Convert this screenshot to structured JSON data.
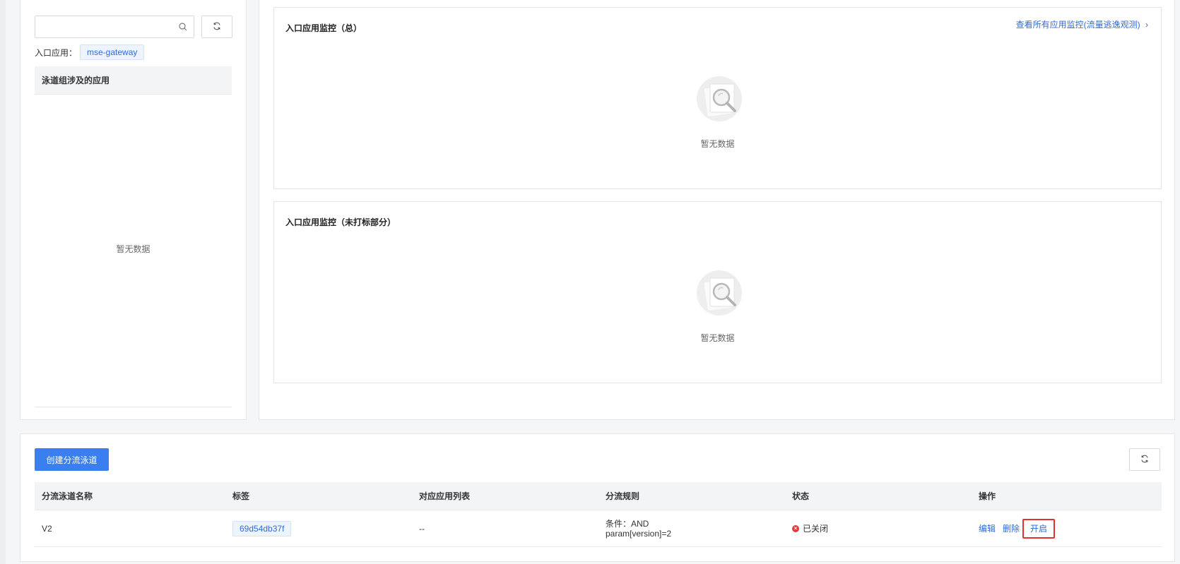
{
  "left_panel": {
    "search": {
      "value": "",
      "placeholder": ""
    },
    "entry_label": "入口应用：",
    "entry_tag": "mse-gateway",
    "list_header": "泳道组涉及的应用",
    "empty_text": "暂无数据"
  },
  "monitors": [
    {
      "title": "入口应用监控（总）",
      "link": "查看所有应用监控(流量逃逸观测)",
      "empty_text": "暂无数据"
    },
    {
      "title": "入口应用监控（未打标部分）",
      "empty_text": "暂无数据"
    }
  ],
  "lanes": {
    "create_button": "创建分流泳道",
    "columns": [
      "分流泳道名称",
      "标签",
      "对应应用列表",
      "分流规则",
      "状态",
      "操作"
    ],
    "rows": [
      {
        "name": "V2",
        "tag": "69d54db37f",
        "apps": "--",
        "rule_line1": "条件：AND",
        "rule_line2": "param[version]=2",
        "status": "已关闭",
        "actions": {
          "edit": "编辑",
          "delete": "删除",
          "enable": "开启"
        }
      }
    ]
  },
  "colors": {
    "primary": "#3a7ef0",
    "link": "#2f6bd6",
    "status_closed": "#e23c39",
    "highlight_border": "#e4312e"
  }
}
